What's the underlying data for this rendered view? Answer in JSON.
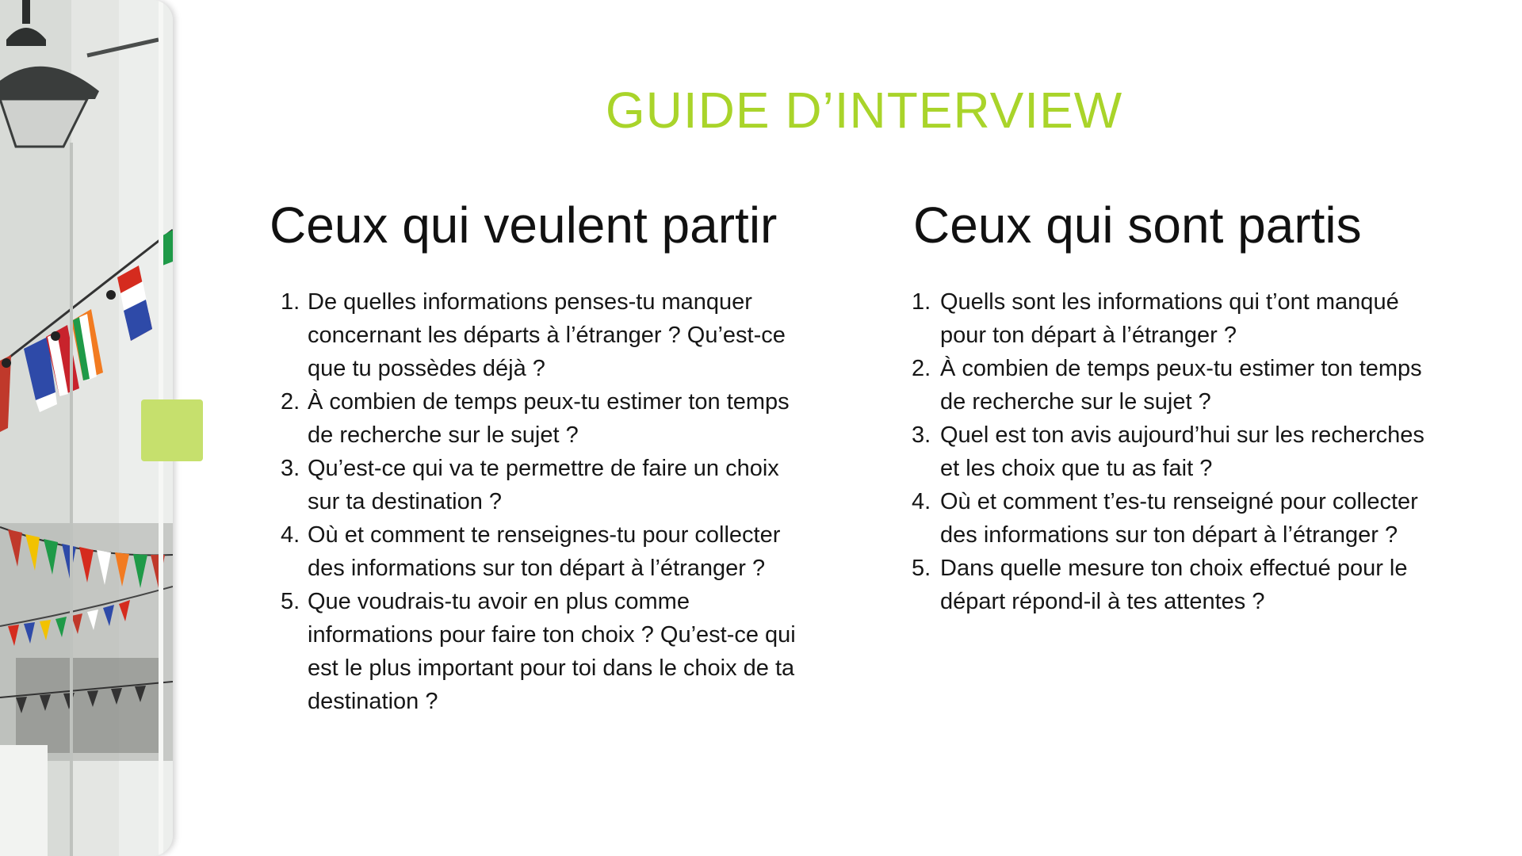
{
  "slide": {
    "title": "GUIDE D’INTERVIEW",
    "accent_color": "#a9d42a",
    "accent_block_color": "#c6e06d",
    "photo_description_icon": "bunting-flags-photo"
  },
  "columns": [
    {
      "heading": "Ceux qui veulent partir",
      "questions": [
        {
          "num": "1.",
          "text": "De quelles informations penses-tu manquer concernant les départs à l’étranger ? Qu’est-ce que tu possèdes déjà ?"
        },
        {
          "num": "2.",
          "text": "À combien de temps peux-tu estimer ton temps de recherche sur le sujet ?"
        },
        {
          "num": "3.",
          "text": "Qu’est-ce qui va te permettre de faire un choix sur ta destination ?"
        },
        {
          "num": "4.",
          "text": "Où et comment te renseignes-tu pour collecter des informations sur ton départ à l’étranger ?"
        },
        {
          "num": "5.",
          "text": "Que voudrais-tu avoir en plus comme informations pour faire ton choix ? Qu’est-ce qui est le plus important pour toi dans le choix de ta destination ?"
        }
      ]
    },
    {
      "heading": "Ceux qui sont partis",
      "questions": [
        {
          "num": "1.",
          "text": "Quells sont les informations qui t’ont manqué pour ton départ à l’étranger ?"
        },
        {
          "num": "2.",
          "text": "À combien de temps peux-tu estimer ton temps de recherche sur le sujet ?"
        },
        {
          "num": "3.",
          "text": "Quel est ton avis aujourd’hui sur les recherches et les choix que tu as fait ?"
        },
        {
          "num": "4.",
          "text": "Où et comment t’es-tu renseigné pour collecter des informations sur ton départ à l’étranger ?"
        },
        {
          "num": "5.",
          "text": "Dans quelle mesure ton choix effectué pour le départ répond-il à tes attentes ?"
        }
      ]
    }
  ]
}
